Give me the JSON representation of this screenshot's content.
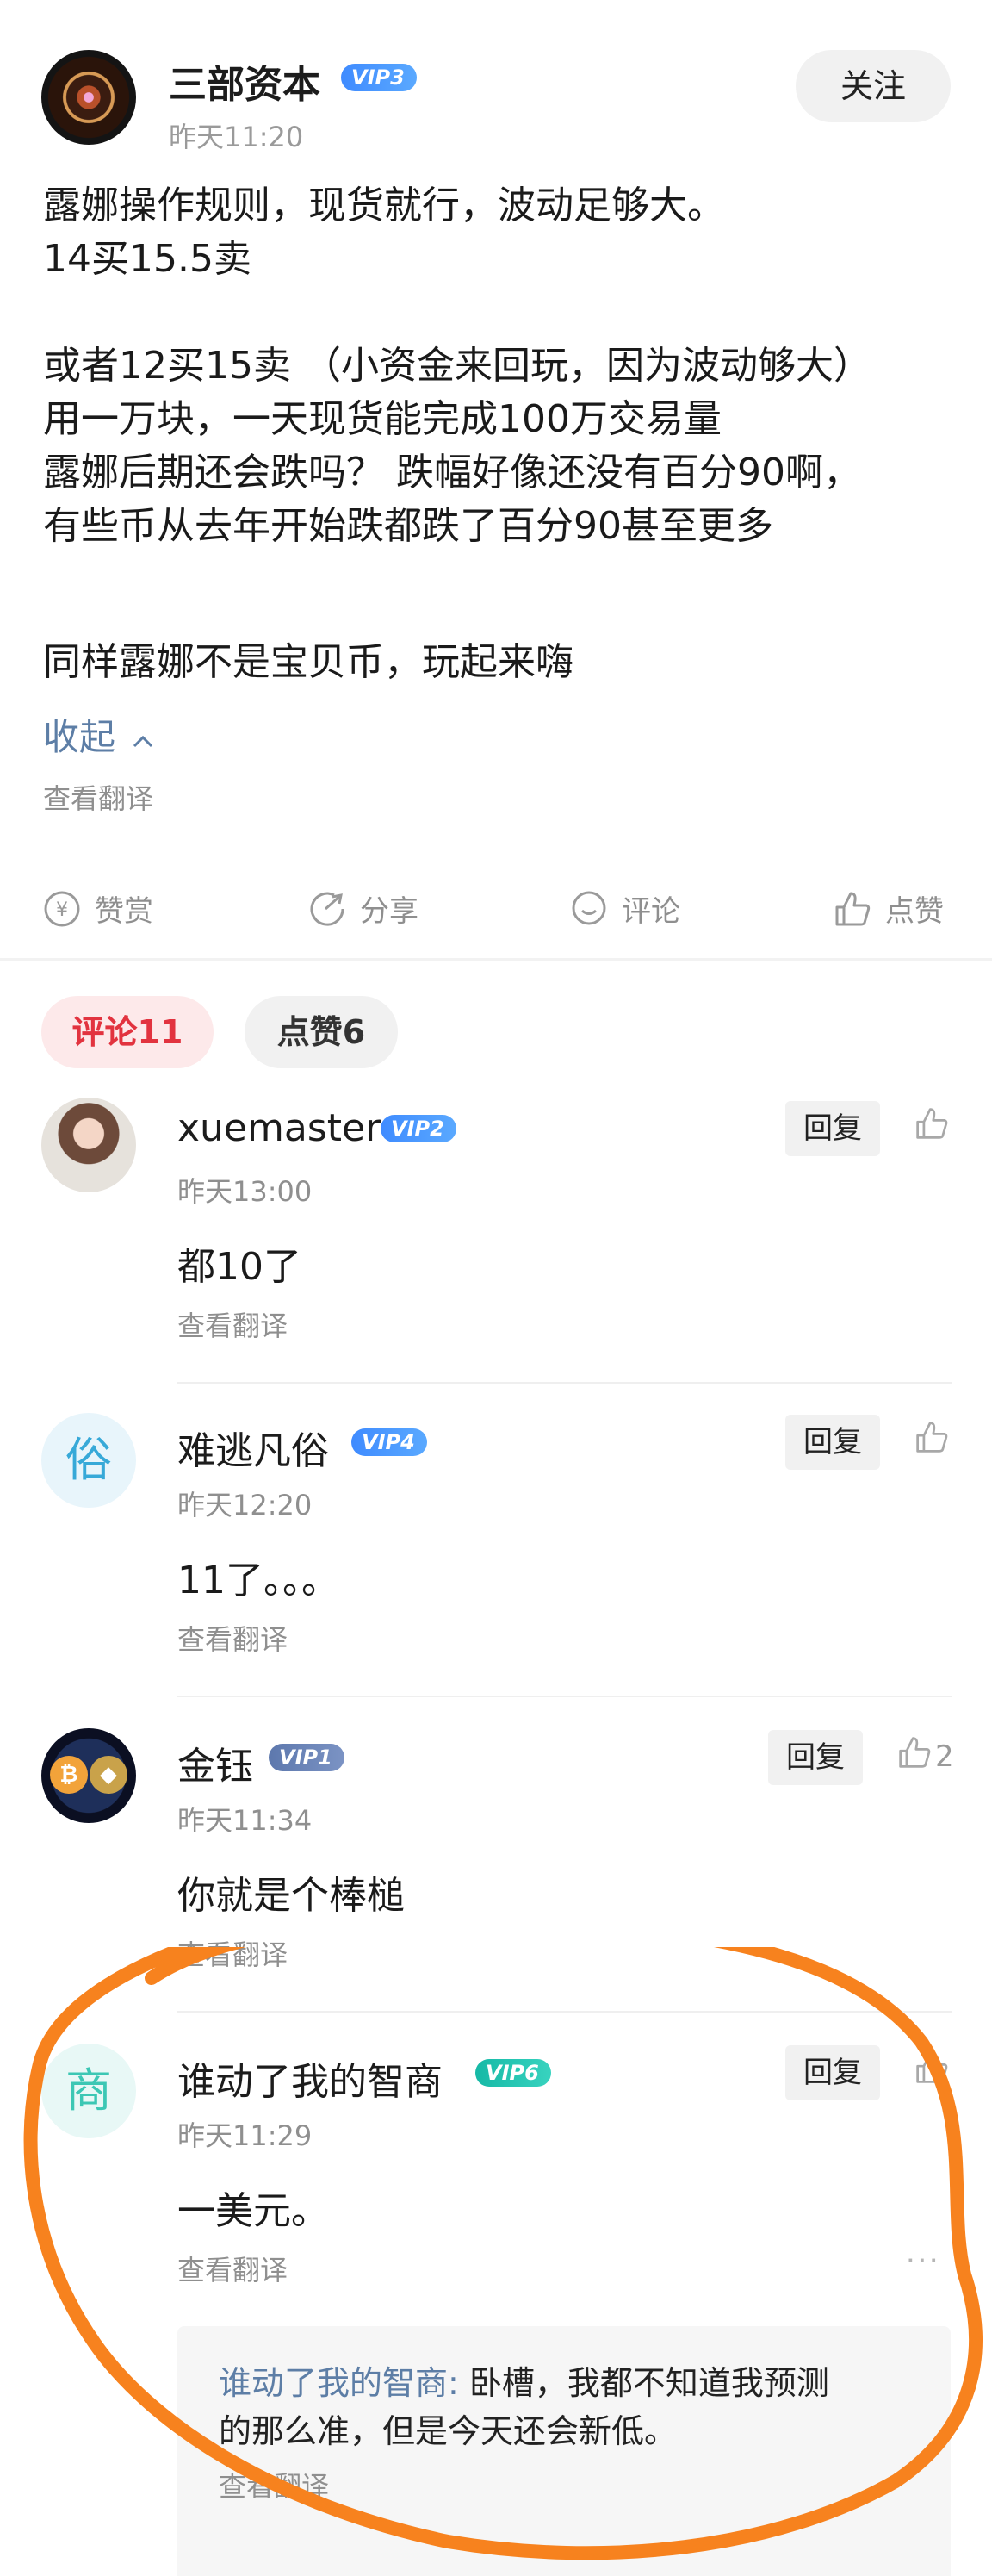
{
  "post": {
    "author": "三部资本",
    "author_vip": "VIP3",
    "time": "昨天11:20",
    "follow_label": "关注",
    "lines": [
      "露娜操作规则，现货就行，波动足够大。",
      "14买15.5卖",
      "或者12买15卖 （小资金来回玩，因为波动够大）",
      "用一万块，一天现货能完成100万交易量",
      "露娜后期还会跌吗？ 跌幅好像还没有百分90啊，",
      "有些币从去年开始跌都跌了百分90甚至更多",
      "同样露娜不是宝贝币，玩起来嗨"
    ],
    "collapse_label": "收起",
    "translate_label": "查看翻译"
  },
  "actions": {
    "reward": "赞赏",
    "share": "分享",
    "comment": "评论",
    "like": "点赞"
  },
  "tabs": {
    "comments": "评论11",
    "likes": "点赞6"
  },
  "comments": [
    {
      "name": "xuemaster",
      "vip": "VIP2",
      "time": "昨天13:00",
      "text": "都10了",
      "translate": "查看翻译",
      "reply": "回复",
      "likes": ""
    },
    {
      "name": "难逃凡俗",
      "avatar_char": "俗",
      "vip": "VIP4",
      "time": "昨天12:20",
      "text": "11了。。。",
      "translate": "查看翻译",
      "reply": "回复",
      "likes": ""
    },
    {
      "name": "金钰",
      "vip": "VIP1",
      "time": "昨天11:34",
      "text": "你就是个棒槌",
      "translate": "查看翻译",
      "reply": "回复",
      "likes": "2"
    },
    {
      "name": "谁动了我的智商",
      "avatar_char": "商",
      "vip": "VIP6",
      "time": "昨天11:29",
      "text": "一美元。",
      "translate": "查看翻译",
      "reply": "回复",
      "likes": ""
    }
  ],
  "sub_reply": {
    "author": "谁动了我的智商",
    "sep": ":",
    "line1": " 卧槽，我都不知道我预测",
    "line2": "的那么准，但是今天还会新低。",
    "translate": "查看翻译"
  },
  "more_label": "···",
  "colors": {
    "vip_blue": "#3f8bff",
    "vip1_slate": "#6a86b8",
    "vip6_teal": "#22c3b0",
    "tab_active_red": "#e2333f",
    "link_blue": "#5d7ea6",
    "annotation_orange": "#f7821e"
  },
  "icons": [
    "avatar",
    "vip-badge",
    "yen-coin-icon",
    "share-icon",
    "comment-bubble-icon",
    "thumbs-up-icon",
    "more-dots-icon"
  ]
}
